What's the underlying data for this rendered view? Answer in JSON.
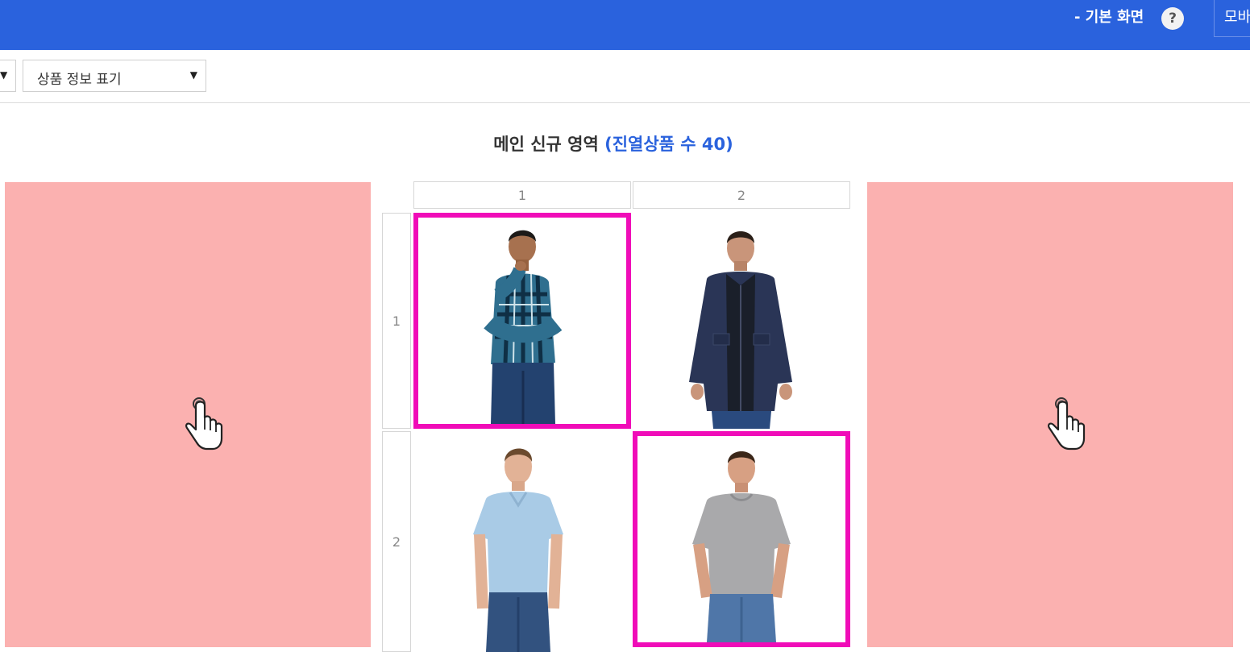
{
  "header": {
    "mode_title": "- 기본 화면",
    "help_icon": "?",
    "mobile_label": "모바"
  },
  "toolbar": {
    "select_left_value": "",
    "select_main_value": "상품 정보 표기",
    "arrow": "▼"
  },
  "area": {
    "title": "메인 신규 영역",
    "count_text": "(진열상품 수 40)"
  },
  "grid": {
    "columns": [
      "1",
      "2"
    ],
    "rows": [
      "1",
      "2"
    ],
    "cells": [
      {
        "name": "product-plaid-shirt-model",
        "selected": true
      },
      {
        "name": "product-navy-jacket-model",
        "selected": false
      },
      {
        "name": "product-light-blue-tshirt-model",
        "selected": false
      },
      {
        "name": "product-gray-tshirt-model",
        "selected": true
      }
    ]
  },
  "nav": {
    "left_icon": "hand-pointer-icon",
    "right_icon": "hand-pointer-icon"
  },
  "colors": {
    "header_bg": "#2a62dd",
    "nav_panel_bg": "#fbb1b0",
    "selected_border": "#f00cb8",
    "count_accent": "#2a62dd"
  }
}
